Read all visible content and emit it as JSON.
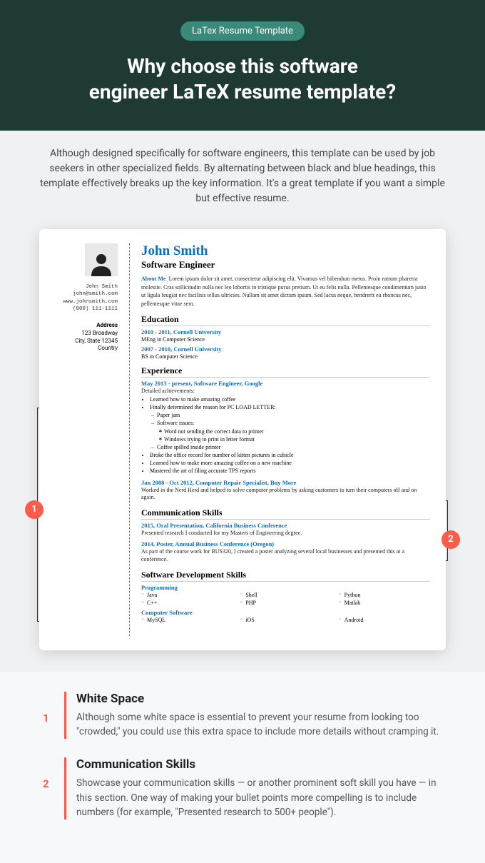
{
  "hero": {
    "badge": "LaTex Resume Template",
    "title_l1": "Why choose this software",
    "title_l2": "engineer LaTeX resume template?"
  },
  "intro": "Although designed specifically for software engineers, this template can be used by job seekers in other specialized fields. By alternating between black and blue headings, this template effectively breaks up the key information. It's a great template if you want a simple but effective resume.",
  "resume": {
    "name": "John Smith",
    "title": "Software Engineer",
    "contact": {
      "name": "John Smith",
      "email": "john@smith.com",
      "web": "www.johnsmith.com",
      "phone": "(000) 111-1111"
    },
    "address": {
      "h": "Address",
      "l1": "123 Broadway",
      "l2": "City, State 12345",
      "l3": "Country"
    },
    "about": {
      "h": "About Me",
      "text": "Lorem ipsum dolor sit amet, consectetur adipiscing elit. Vivamus vel bibendum metus. Proin rutrum pharetra molestie. Cras sollicitudin nulla nec leo lobortis in tristique purus pretium. Ut eu felis nulla. Pellentesque condimentum justo ut ligula feugiat nec facilisis tellus ultricies. Nullam sit amet dictum ipsum. Sed lacus neque, hendrerit eu rhoncus nec, pellentesque vitae sem."
    },
    "edu": {
      "h": "Education",
      "items": [
        {
          "range": "2010 - 2011, Cornell University",
          "deg": "MEng in Computer Science"
        },
        {
          "range": "2007 - 2010, Cornell University",
          "deg": "BS in Computer Science"
        }
      ]
    },
    "exp": {
      "h": "Experience",
      "job1": {
        "line": "May 2013 - present, Software Engineer, Google",
        "sub": "Detailed achievements:",
        "b1": "Learned how to make amazing coffee",
        "b2": "Finally determined the reason for PC LOAD LETTER:",
        "b2a": "Paper jam",
        "b2b": "Software issues:",
        "b2b1": "Word not sending the correct data to printer",
        "b2b2": "Windows trying to print in letter format",
        "b2c": "Coffee spilled inside printer",
        "b3": "Broke the office record for number of kitten pictures in cubicle",
        "b4": "Learned how to make more amazing coffee on a new machine",
        "b5": "Mastered the art of filing accurate TPS reports"
      },
      "job2": {
        "line": "Jan 2008 - Oct 2012, Computer Repair Specialist, Buy More",
        "text": "Worked in the Nerd Herd and helped to solve computer problems by asking customers to turn their computers off and on again."
      }
    },
    "comm": {
      "h": "Communication Skills",
      "i1": {
        "line": "2015, Oral Presentation, California Business Conference",
        "text": "Presented research I conducted for my Masters of Engineering degree."
      },
      "i2": {
        "line": "2014, Poster, Annual Business Conference (Oregon)",
        "text": "As part of the course work for BUS320, I created a poster analyzing several local businesses and presented this at a conference."
      }
    },
    "skills": {
      "h": "Software Development Skills",
      "prog": {
        "h": "Programming",
        "items": [
          "Java",
          "Shell",
          "Python",
          "C++",
          "PHP",
          "Matlab"
        ]
      },
      "soft": {
        "h": "Computer Software",
        "items": [
          "MySQL",
          "iOS",
          "Android"
        ]
      }
    }
  },
  "callouts": {
    "c1": "1",
    "c2": "2"
  },
  "notes": [
    {
      "num": "1",
      "h": "White Space",
      "t": "Although some white space is essential to prevent your resume from looking too \"crowded,\" you could use this extra space to include more details without cramping it."
    },
    {
      "num": "2",
      "h": "Communication Skills",
      "t": "Showcase your communication skills — or another prominent soft skill you have — in this section. One way of making your bullet points more compelling is to include numbers (for example, \"Presented research to 500+ people\")."
    }
  ]
}
